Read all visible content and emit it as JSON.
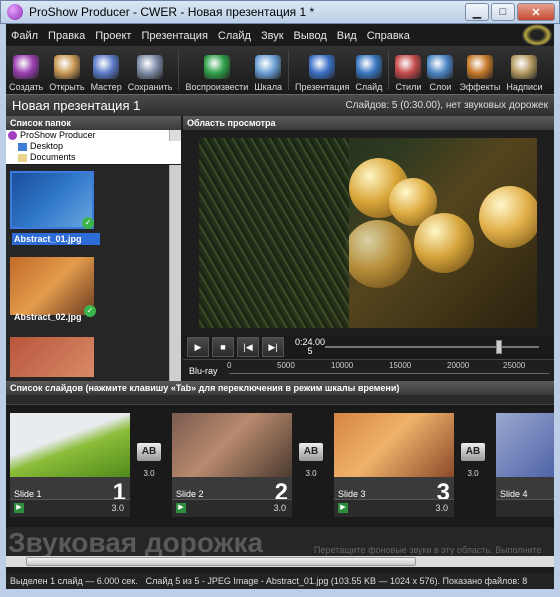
{
  "window": {
    "title": "ProShow Producer - CWER - Новая презентация 1 *",
    "min": "▁",
    "max": "□",
    "close": "✕"
  },
  "menu": [
    "Файл",
    "Правка",
    "Проект",
    "Презентация",
    "Слайд",
    "Звук",
    "Вывод",
    "Вид",
    "Справка"
  ],
  "toolbar": [
    {
      "label": "Создать",
      "color": "#9a3fb0"
    },
    {
      "label": "Открыть",
      "color": "#c99a56"
    },
    {
      "label": "Мастер",
      "color": "#5b7cc9"
    },
    {
      "label": "Сохранить",
      "color": "#7e8ca6"
    },
    {
      "label": "Воспроизвести",
      "color": "#2fa14a"
    },
    {
      "label": "Шкала",
      "color": "#6aa0d4"
    },
    {
      "label": "Презентация",
      "color": "#3b70c7"
    },
    {
      "label": "Слайд",
      "color": "#3a78c2"
    },
    {
      "label": "Стили",
      "color": "#c64c4c"
    },
    {
      "label": "Слои",
      "color": "#4d87c6"
    },
    {
      "label": "Эффекты",
      "color": "#c67a2a"
    },
    {
      "label": "Надписи",
      "color": "#b59a62"
    }
  ],
  "project": {
    "name": "Новая презентация 1",
    "info": "Слайдов: 5 (0:30.00), нет звуковых дорожек"
  },
  "folders": {
    "header": "Список папок",
    "items": [
      "ProShow Producer",
      "Desktop",
      "Documents"
    ]
  },
  "files": [
    {
      "name": "Abstract_01.jpg",
      "selected": true
    },
    {
      "name": "Abstract_02.jpg",
      "selected": false
    }
  ],
  "preview": {
    "header": "Область просмотра",
    "time": "0:24.00",
    "slide": "5"
  },
  "ruler": {
    "label": "Blu-ray",
    "ticks": [
      "0",
      "5000",
      "10000",
      "15000",
      "20000",
      "25000"
    ]
  },
  "slides": {
    "header": "Список слайдов (нажмите клавишу «Tab» для переключения в режим шкалы времени)",
    "items": [
      {
        "name": "Slide 1",
        "num": "1",
        "dur": "3.0"
      },
      {
        "name": "Slide 2",
        "num": "2",
        "dur": "3.0"
      },
      {
        "name": "Slide 3",
        "num": "3",
        "dur": "3.0"
      },
      {
        "name": "Slide 4",
        "num": "",
        "dur": ""
      }
    ],
    "transitions": [
      "3.0",
      "3.0",
      "3.0"
    ],
    "ab": "AB"
  },
  "audio": {
    "title": "Звуковая дорожка",
    "hint": "Перетащите фоновые звуки в эту область. Выполните"
  },
  "status": {
    "left": "Выделен 1 слайд — 6.000 сек.",
    "mid": "Слайд 5 из 5 - JPEG Image - Abstract_01.jpg (103.55 KB — 1024 x 576). Показано файлов: 8"
  }
}
